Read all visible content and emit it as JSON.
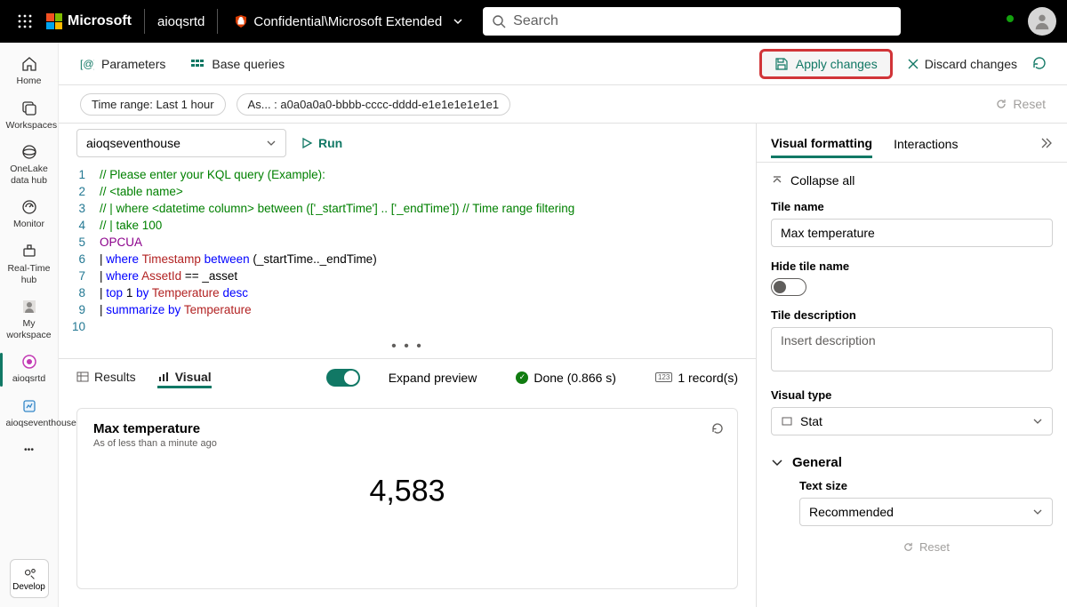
{
  "header": {
    "brand": "Microsoft",
    "workspace": "aioqsrtd",
    "sensitivity": "Confidential\\Microsoft Extended",
    "search_placeholder": "Search"
  },
  "rail": {
    "items": [
      {
        "label": "Home"
      },
      {
        "label": "Workspaces"
      },
      {
        "label": "OneLake data hub"
      },
      {
        "label": "Monitor"
      },
      {
        "label": "Real-Time hub"
      },
      {
        "label": "My workspace"
      },
      {
        "label": "aioqsrtd"
      },
      {
        "label": "aioqseventhouse"
      }
    ],
    "develop": "Develop"
  },
  "toolbar": {
    "parameters": "Parameters",
    "base_queries": "Base queries",
    "apply": "Apply changes",
    "discard": "Discard changes"
  },
  "filters": {
    "time_range": "Time range: Last 1 hour",
    "asset": "As... : a0a0a0a0-bbbb-cccc-dddd-e1e1e1e1e1e1",
    "reset": "Reset"
  },
  "query": {
    "db": "aioqseventhouse",
    "run": "Run",
    "lines": [
      {
        "n": "1",
        "html": "<span class='c-comm'>// Please enter your KQL query (Example):</span>"
      },
      {
        "n": "2",
        "html": "<span class='c-comm'>// &lt;table name&gt;</span>"
      },
      {
        "n": "3",
        "html": "<span class='c-comm'>// | where &lt;datetime column&gt; between (['_startTime'] .. ['_endTime']) // Time range filtering</span>"
      },
      {
        "n": "4",
        "html": "<span class='c-comm'>// | take 100</span>"
      },
      {
        "n": "5",
        "html": "<span class='c-tbl'>OPCUA</span>"
      },
      {
        "n": "6",
        "html": "<span class='c-id'>| </span><span class='c-kw'>where</span> <span class='c-fn'>Timestamp</span> <span class='c-kw'>between</span> <span class='c-par'>(_startTime.._endTime)</span>"
      },
      {
        "n": "7",
        "html": "<span class='c-id'>| </span><span class='c-kw'>where</span> <span class='c-fn'>AssetId</span> == <span class='c-id'>_asset</span>"
      },
      {
        "n": "8",
        "html": "<span class='c-id'>| </span><span class='c-kw'>top</span> <span class='c-id'>1</span> <span class='c-kw'>by</span> <span class='c-fn'>Temperature</span> <span class='c-kw'>desc</span>"
      },
      {
        "n": "9",
        "html": "<span class='c-id'>| </span><span class='c-kw'>summarize</span> <span class='c-kw'>by</span> <span class='c-fn'>Temperature</span>"
      },
      {
        "n": "10",
        "html": ""
      }
    ]
  },
  "results": {
    "results_tab": "Results",
    "visual_tab": "Visual",
    "expand": "Expand preview",
    "done": "Done (0.866 s)",
    "records": "1 record(s)"
  },
  "tile": {
    "title": "Max temperature",
    "subtitle": "As of less than a minute ago",
    "value": "4,583"
  },
  "panel": {
    "tab_visual": "Visual formatting",
    "tab_inter": "Interactions",
    "collapse": "Collapse all",
    "tile_name_label": "Tile name",
    "tile_name": "Max temperature",
    "hide_label": "Hide tile name",
    "desc_label": "Tile description",
    "desc_placeholder": "Insert description",
    "vtype_label": "Visual type",
    "vtype": "Stat",
    "general": "General",
    "text_size_label": "Text size",
    "text_size": "Recommended",
    "reset": "Reset"
  }
}
